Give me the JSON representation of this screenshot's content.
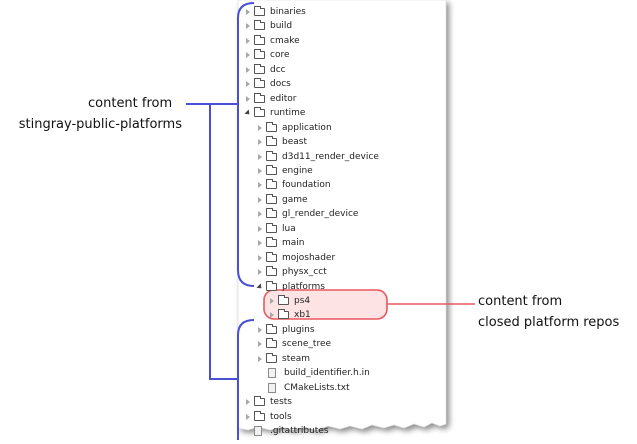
{
  "tree": [
    {
      "label": "binaries",
      "depth": 0,
      "kind": "folder",
      "expand": "closed"
    },
    {
      "label": "build",
      "depth": 0,
      "kind": "folder",
      "expand": "closed"
    },
    {
      "label": "cmake",
      "depth": 0,
      "kind": "folder",
      "expand": "closed"
    },
    {
      "label": "core",
      "depth": 0,
      "kind": "folder",
      "expand": "closed"
    },
    {
      "label": "dcc",
      "depth": 0,
      "kind": "folder",
      "expand": "closed"
    },
    {
      "label": "docs",
      "depth": 0,
      "kind": "folder",
      "expand": "closed"
    },
    {
      "label": "editor",
      "depth": 0,
      "kind": "folder",
      "expand": "closed"
    },
    {
      "label": "runtime",
      "depth": 0,
      "kind": "folder",
      "expand": "open"
    },
    {
      "label": "application",
      "depth": 1,
      "kind": "folder",
      "expand": "closed"
    },
    {
      "label": "beast",
      "depth": 1,
      "kind": "folder",
      "expand": "closed"
    },
    {
      "label": "d3d11_render_device",
      "depth": 1,
      "kind": "folder",
      "expand": "closed"
    },
    {
      "label": "engine",
      "depth": 1,
      "kind": "folder",
      "expand": "closed"
    },
    {
      "label": "foundation",
      "depth": 1,
      "kind": "folder",
      "expand": "closed"
    },
    {
      "label": "game",
      "depth": 1,
      "kind": "folder",
      "expand": "closed"
    },
    {
      "label": "gl_render_device",
      "depth": 1,
      "kind": "folder",
      "expand": "closed"
    },
    {
      "label": "lua",
      "depth": 1,
      "kind": "folder",
      "expand": "closed"
    },
    {
      "label": "main",
      "depth": 1,
      "kind": "folder",
      "expand": "closed"
    },
    {
      "label": "mojoshader",
      "depth": 1,
      "kind": "folder",
      "expand": "closed"
    },
    {
      "label": "physx_cct",
      "depth": 1,
      "kind": "folder",
      "expand": "closed"
    },
    {
      "label": "platforms",
      "depth": 1,
      "kind": "folder",
      "expand": "open"
    },
    {
      "label": "ps4",
      "depth": 2,
      "kind": "folder",
      "expand": "closed"
    },
    {
      "label": "xb1",
      "depth": 2,
      "kind": "folder",
      "expand": "closed"
    },
    {
      "label": "plugins",
      "depth": 1,
      "kind": "folder",
      "expand": "closed"
    },
    {
      "label": "scene_tree",
      "depth": 1,
      "kind": "folder",
      "expand": "closed"
    },
    {
      "label": "steam",
      "depth": 1,
      "kind": "folder",
      "expand": "closed"
    },
    {
      "label": "build_identifier.h.in",
      "depth": 2,
      "kind": "file",
      "expand": "none"
    },
    {
      "label": "CMakeLists.txt",
      "depth": 2,
      "kind": "file",
      "expand": "none"
    },
    {
      "label": "tests",
      "depth": 0,
      "kind": "folder",
      "expand": "closed"
    },
    {
      "label": "tools",
      "depth": 0,
      "kind": "folder",
      "expand": "closed"
    },
    {
      "label": ".gitattributes",
      "depth": 0,
      "kind": "file",
      "expand": "none"
    }
  ],
  "annotations": {
    "left_line1": "content from",
    "left_line2": "stingray-public-platforms",
    "right_line1": "content from",
    "right_line2": "closed platform repos"
  },
  "colors": {
    "bracket": "#4a4fd6",
    "highlight_stroke": "#e8585f",
    "highlight_fill": "#fde3e4",
    "background": "#ffffff"
  }
}
